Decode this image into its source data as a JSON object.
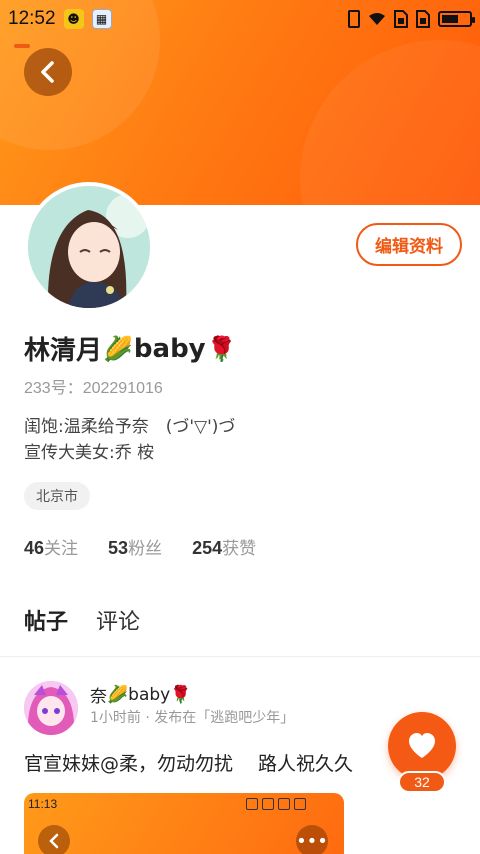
{
  "status_bar": {
    "time": "12:52",
    "icons": [
      "app-icon-yellow",
      "app-icon-map",
      "vibrate-icon",
      "wifi-icon",
      "sim-icon",
      "sim-icon",
      "battery-icon"
    ],
    "battery_level": 0.6
  },
  "profile": {
    "name_prefix": "林清月",
    "name_mid": "baby",
    "emoji_corn": "🌽",
    "emoji_rose": "🌹",
    "id_label": "233号：202291016",
    "bio_line1": "闺饱:温柔给予奈　(づ'▽')づ",
    "bio_line2": "宣传大美女:乔 桉",
    "location": "北京市",
    "edit_label": "编辑资料"
  },
  "stats": [
    {
      "count": "46",
      "label": "关注"
    },
    {
      "count": "53",
      "label": "粉丝"
    },
    {
      "count": "254",
      "label": "获赞"
    }
  ],
  "tabs": [
    {
      "label": "帖子",
      "active": true
    },
    {
      "label": "评论",
      "active": false
    }
  ],
  "post": {
    "author_prefix": "奈",
    "author_mid": "baby",
    "meta": "1小时前 · 发布在「逃跑吧少年」",
    "text": "官宣妹妹@柔，勿动勿扰　 路人祝久久",
    "like_count": "32",
    "image_time": "11:13"
  },
  "colors": {
    "accent": "#f05a14",
    "header_start": "#ff9a1a",
    "header_end": "#ff5a0a"
  }
}
